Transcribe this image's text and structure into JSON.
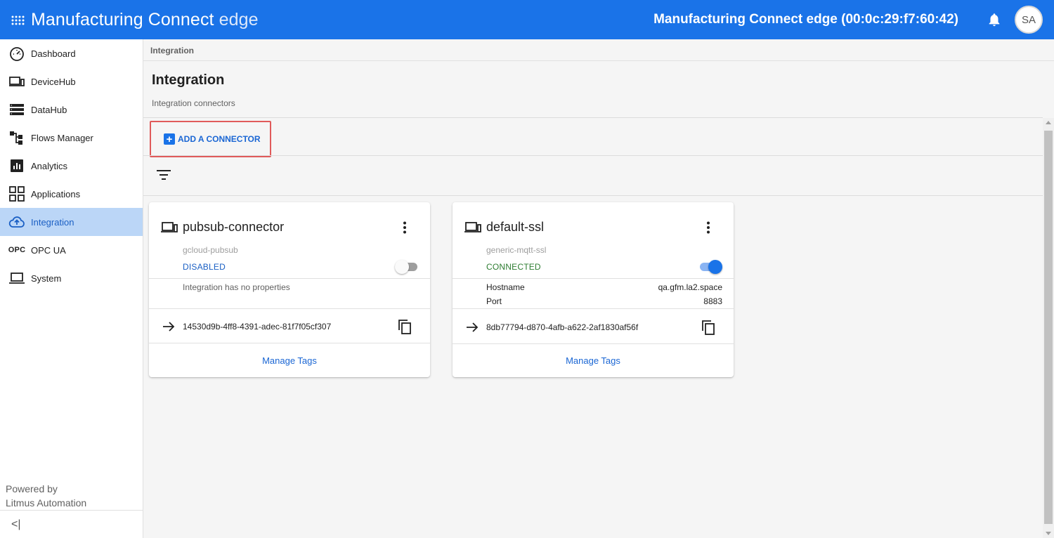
{
  "header": {
    "app_name": "Manufacturing Connect",
    "app_name_suffix": " edge",
    "device_title": "Manufacturing Connect edge (00:0c:29:f7:60:42)",
    "avatar_initials": "SA",
    "color": "#1a73e8"
  },
  "sidebar": {
    "items": [
      {
        "label": "Dashboard",
        "icon": "gauge-icon"
      },
      {
        "label": "DeviceHub",
        "icon": "devices-icon"
      },
      {
        "label": "DataHub",
        "icon": "storage-icon"
      },
      {
        "label": "Flows Manager",
        "icon": "flow-icon"
      },
      {
        "label": "Analytics",
        "icon": "analytics-icon"
      },
      {
        "label": "Applications",
        "icon": "grid-icon"
      },
      {
        "label": "Integration",
        "icon": "cloud-upload-icon"
      },
      {
        "label": "OPC UA",
        "icon": "opc-text",
        "icon_text": "OPC"
      },
      {
        "label": "System",
        "icon": "laptop-icon"
      }
    ],
    "active": "Integration",
    "powered_line1": "Powered by",
    "powered_line2": "Litmus Automation",
    "collapse_glyph": "<|"
  },
  "main": {
    "breadcrumb": "Integration",
    "title": "Integration",
    "subtitle": "Integration connectors",
    "add_button_label": "ADD A CONNECTOR"
  },
  "cards": [
    {
      "name": "pubsub-connector",
      "type": "gcloud-pubsub",
      "status": "DISABLED",
      "enabled": false,
      "no_properties_text": "Integration has no properties",
      "properties": [],
      "uuid": "14530d9b-4ff8-4391-adec-81f7f05cf307",
      "manage_label": "Manage Tags"
    },
    {
      "name": "default-ssl",
      "type": "generic-mqtt-ssl",
      "status": "CONNECTED",
      "enabled": true,
      "properties": [
        {
          "key": "Hostname",
          "value": "qa.gfm.la2.space"
        },
        {
          "key": "Port",
          "value": "8883"
        }
      ],
      "uuid": "8db77794-d870-4afb-a622-2af1830af56f",
      "manage_label": "Manage Tags"
    }
  ]
}
